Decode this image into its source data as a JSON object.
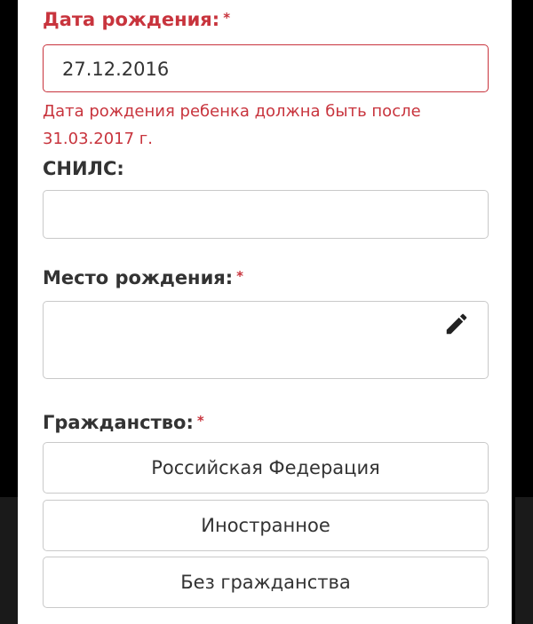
{
  "birth_date": {
    "label": "Дата рождения:",
    "required_mark": "*",
    "value": "27.12.2016",
    "error": "Дата рождения ребенка должна быть после 31.03.2017 г."
  },
  "snils": {
    "label": "СНИЛС:",
    "value": ""
  },
  "birth_place": {
    "label": "Место рождения:",
    "required_mark": "*",
    "value": "",
    "edit_icon": "pencil-icon"
  },
  "citizenship": {
    "label": "Гражданство:",
    "required_mark": "*",
    "options": [
      {
        "label": "Российская Федерация"
      },
      {
        "label": "Иностранное"
      },
      {
        "label": "Без гражданства"
      }
    ]
  },
  "colors": {
    "error": "#c8343d",
    "text": "#333333",
    "border": "#c9c9c9"
  }
}
